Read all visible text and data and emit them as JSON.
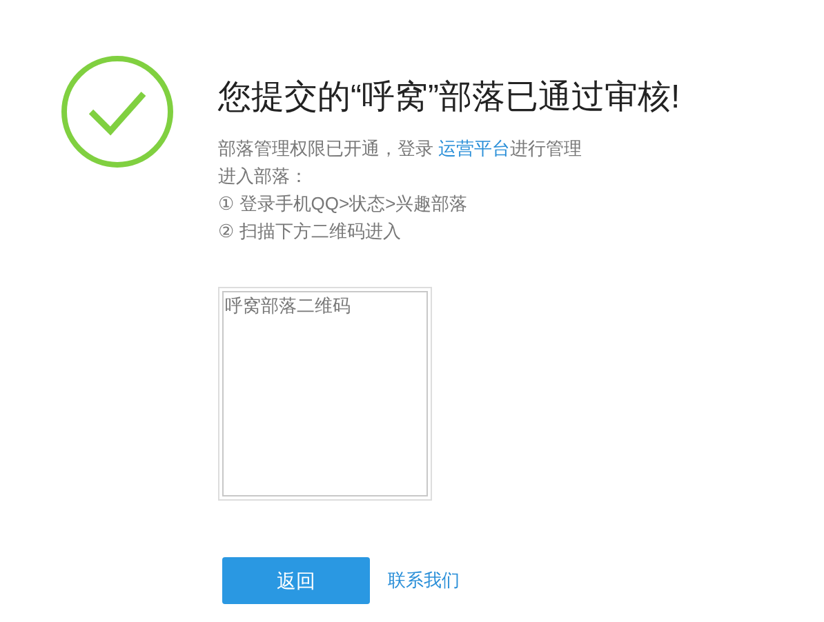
{
  "title": "您提交的“呼窝”部落已通过审核!",
  "notice": {
    "before": "部落管理权限已开通，登录 ",
    "link": "运营平台",
    "after": "进行管理"
  },
  "steps_heading": "进入部落：",
  "steps": [
    "① 登录手机QQ>状态>兴趣部落",
    "② 扫描下方二维码进入"
  ],
  "qr_code": {
    "alt_text": "呼窝部落二维码"
  },
  "buttons": {
    "back": "返回",
    "contact": "联系我们"
  }
}
